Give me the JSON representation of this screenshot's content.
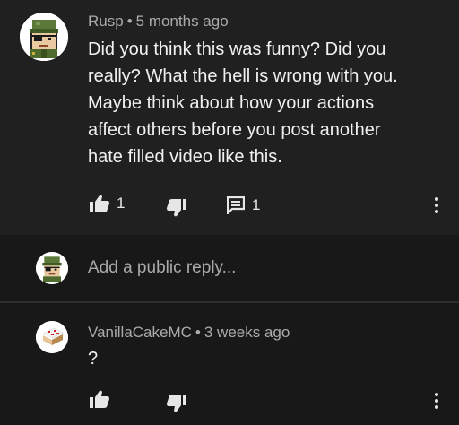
{
  "comment": {
    "author": "Rusp",
    "separator": "•",
    "time": "5 months ago",
    "text_lines": [
      "Did you think this was funny? Did you",
      "really? What the hell is wrong with you.",
      "Maybe think about how your actions",
      "affect others before you post another",
      "hate filled video like this."
    ],
    "like_count": "1",
    "reply_count": "1",
    "icons": {
      "like": "thumbs-up-icon",
      "dislike": "thumbs-down-icon",
      "replies": "comment-bubble-icon",
      "menu": "more-vertical-icon"
    }
  },
  "reply_box": {
    "placeholder": "Add a public reply..."
  },
  "reply": {
    "author": "VanillaCakeMC",
    "separator": "•",
    "time": "3 weeks ago",
    "text": "?"
  },
  "colors": {
    "comment_bg": "#202020",
    "page_bg": "#181818",
    "meta_text": "#aaaaaa",
    "body_text": "#f1f1f1"
  }
}
